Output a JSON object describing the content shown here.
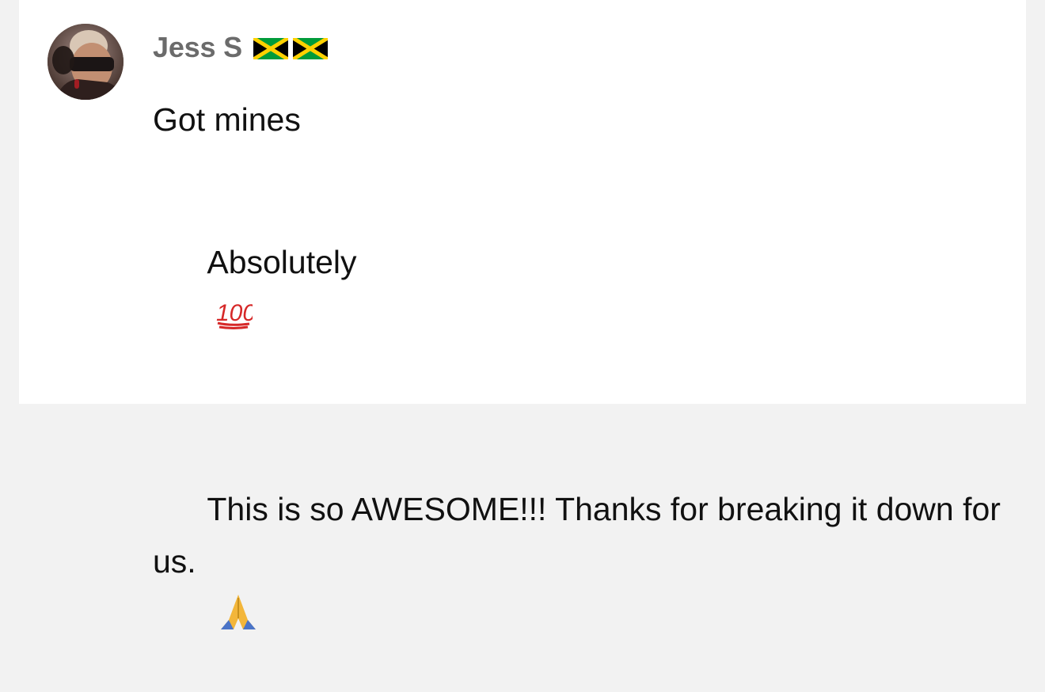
{
  "comment": {
    "author": {
      "name": "Jess S",
      "badges": [
        "jamaica-flag-icon",
        "jamaica-flag-icon"
      ],
      "avatar": "profile-photo-avatar"
    },
    "paragraphs": [
      "Got mines",
      "Absolutely",
      "This is so AWESOME!!! Thanks for breaking it down for us."
    ],
    "emojis": {
      "absolutely": "hundred-points-icon",
      "thanks": "praying-hands-icon"
    },
    "colors": {
      "username": "#6b6b6b",
      "text": "#111111",
      "background": "#ffffff",
      "page": "#f2f2f2"
    }
  }
}
